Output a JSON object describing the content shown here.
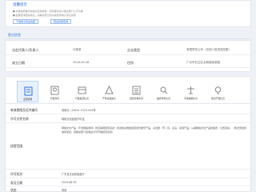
{
  "notice": {
    "badge": "温馨提示",
    "line1": "■ 本网站所展示的信息仅供参考，如有疑问请以相关部门公示为准",
    "line2": "■ 如需查询更多信息，请联系登记机关或使用电子营业执照",
    "buttons": [
      "下载电子营业执照",
      "营业执照查询"
    ]
  },
  "registration": {
    "section_title": "登记信息",
    "rows": [
      {
        "label": "法定代表人/负责人",
        "value": "马某某",
        "label2": "企业类型",
        "value2": "有限责任公司（自然人投资或控股）"
      },
      {
        "label": "成立日期",
        "value": "2018-05-08",
        "label2": "住所",
        "value2": "广州市白云区太和镇某某路"
      }
    ]
  },
  "services": {
    "tabs": [
      "证照管理",
      "行政许可",
      "行政处罚信息",
      "严重违法失信",
      "经营异常名录",
      "抽查检查信息",
      "司法协助信息",
      "知识产权信息"
    ],
    "active_tab": 0
  },
  "details": {
    "items": [
      {
        "key": "有效期限及证件编号",
        "value": "粤网文（2019）0123-005号"
      },
      {
        "key": "许可文件名称",
        "value": "网络文化经营许可证"
      },
      {
        "key": "经营范围",
        "value": "网络文化产品（不含网络游戏）的互联网经营活动：利用信息网络经营音乐娱乐产品，演出剧（节）目，表演，动漫产品；从事网络文化产品的展览、比赛活动。（依法须经批准的项目，经相关部门批准后方可开展经营活动）"
      },
      {
        "key": "许可机关",
        "value": "广东省文化和旅游厅"
      },
      {
        "key": "发证日期",
        "value": "2019-08-05"
      },
      {
        "key": "状态",
        "value": "有效"
      }
    ]
  },
  "colors": {
    "accent": "#2f6fd6",
    "background": "#eef2f7"
  }
}
